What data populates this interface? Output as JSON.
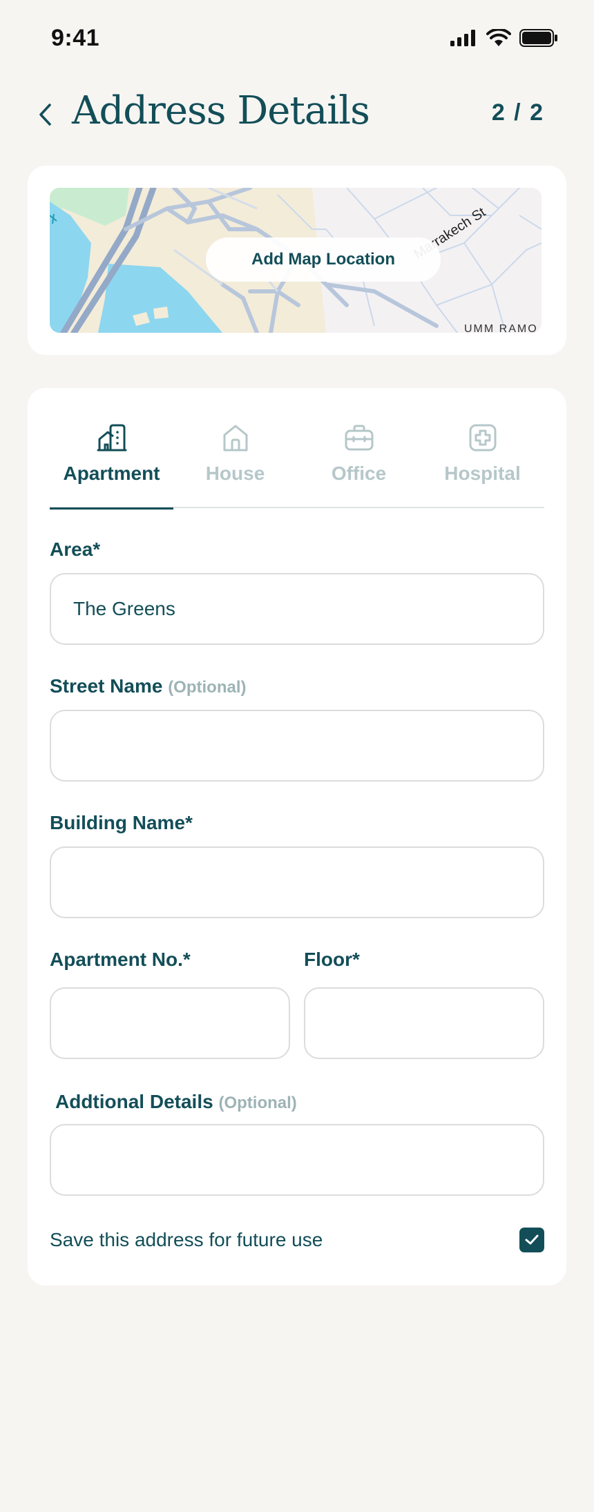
{
  "status_bar": {
    "time": "9:41",
    "icons": [
      "cellular-signal-icon",
      "wifi-icon",
      "battery-icon"
    ]
  },
  "header": {
    "back_icon": "chevron-left-icon",
    "title": "Address Details",
    "step": "2 / 2"
  },
  "map": {
    "button_label": "Add Map Location",
    "street_label": "Marrakech St",
    "area_label": "UMM RAMO"
  },
  "tabs": [
    {
      "label": "Apartment",
      "icon": "apartment-building-icon",
      "active": true
    },
    {
      "label": "House",
      "icon": "house-icon",
      "active": false
    },
    {
      "label": "Office",
      "icon": "briefcase-icon",
      "active": false
    },
    {
      "label": "Hospital",
      "icon": "hospital-cross-icon",
      "active": false
    }
  ],
  "form": {
    "area": {
      "label": "Area*",
      "value": "The Greens"
    },
    "street": {
      "label": "Street Name",
      "optional": "(Optional)",
      "value": ""
    },
    "building": {
      "label": "Building Name*",
      "value": ""
    },
    "apartment_no": {
      "label": "Apartment No.*",
      "value": ""
    },
    "floor": {
      "label": "Floor*",
      "value": ""
    },
    "additional": {
      "label": "Addtional Details",
      "optional": "(Optional)",
      "value": ""
    }
  },
  "save": {
    "label": "Save this address for future use",
    "checked": true
  },
  "colors": {
    "primary": "#134e58",
    "background": "#f6f5f2",
    "inactive": "#b6c7c9",
    "optional_text": "#9db3b6",
    "map_water": "#8dd6ef",
    "map_land": "#f3ecd9",
    "map_park": "#c9ecd1",
    "map_highway": "#93a9c7"
  }
}
